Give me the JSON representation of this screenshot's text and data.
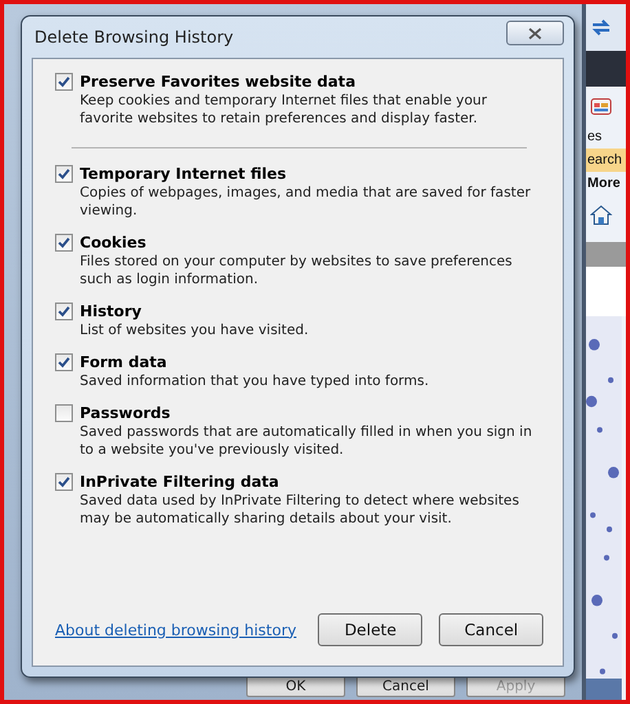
{
  "dialog": {
    "title": "Delete Browsing History",
    "preserve": {
      "label": "Preserve Favorites website data",
      "description": "Keep cookies and temporary Internet files that enable your favorite websites to retain preferences and display faster.",
      "checked": true
    },
    "options": [
      {
        "label": "Temporary Internet files",
        "description": "Copies of webpages, images, and media that are saved for faster viewing.",
        "checked": true
      },
      {
        "label": "Cookies",
        "description": "Files stored on your computer by websites to save preferences such as login information.",
        "checked": true
      },
      {
        "label": "History",
        "description": "List of websites you have visited.",
        "checked": true
      },
      {
        "label": "Form data",
        "description": "Saved information that you have typed into forms.",
        "checked": true
      },
      {
        "label": "Passwords",
        "description": "Saved passwords that are automatically filled in when you sign in to a website you've previously visited.",
        "checked": false
      },
      {
        "label": "InPrivate Filtering data",
        "description": "Saved data used by InPrivate Filtering to detect where websites may be automatically sharing details about your visit.",
        "checked": true
      }
    ],
    "link": "About deleting browsing history",
    "buttons": [
      "Delete",
      "Cancel"
    ]
  },
  "background_window": {
    "buttons": [
      {
        "label": "OK",
        "disabled": false
      },
      {
        "label": "Cancel",
        "disabled": false
      },
      {
        "label": "Apply",
        "disabled": true
      }
    ]
  },
  "browser": {
    "tools_label": "es",
    "search_label": "earch",
    "more_label": "More"
  }
}
